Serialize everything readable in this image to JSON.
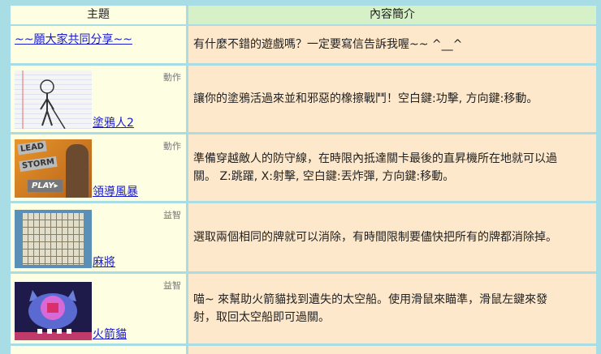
{
  "header": {
    "col_topic": "主題",
    "col_desc": "內容簡介"
  },
  "intro": {
    "link": "~~願大家共同分享~~",
    "desc": "有什麼不錯的遊戲嗎？一定要寫信告訴我喔~~ ^__^"
  },
  "games": [
    {
      "title": "塗鴉人2",
      "category": "動作",
      "desc": [
        "讓你的塗鴉活過來並和邪惡的橡擦戰鬥！空白鍵:功擊, 方向鍵:移動。"
      ],
      "thumb": "doodle-man-thumbnail"
    },
    {
      "title": "領導風暴",
      "category": "動作",
      "desc": [
        "準備穿越敵人的防守線，在時限內抵達關卡最後的直昇機所在地就可以過",
        "關。 Z:跳躍, X:射擊, 空白鍵:丟炸彈, 方向鍵:移動。"
      ],
      "thumb": "lead-storm-thumbnail",
      "thumb_text": [
        "LEAD",
        "STORM",
        "PLAY▸"
      ]
    },
    {
      "title": "麻將",
      "category": "益智",
      "desc": [
        "選取兩個相同的牌就可以消除，有時間限制要儘快把所有的牌都消除掉。"
      ],
      "thumb": "mahjong-thumbnail"
    },
    {
      "title": "火箭貓",
      "category": "益智",
      "desc": [
        "喵~ 來幫助火箭貓找到遺失的太空船。使用滑鼠來瞄準，滑鼠左鍵來發",
        "射，取回太空船即可過關。"
      ],
      "thumb": "rocket-cat-thumbnail"
    }
  ]
}
